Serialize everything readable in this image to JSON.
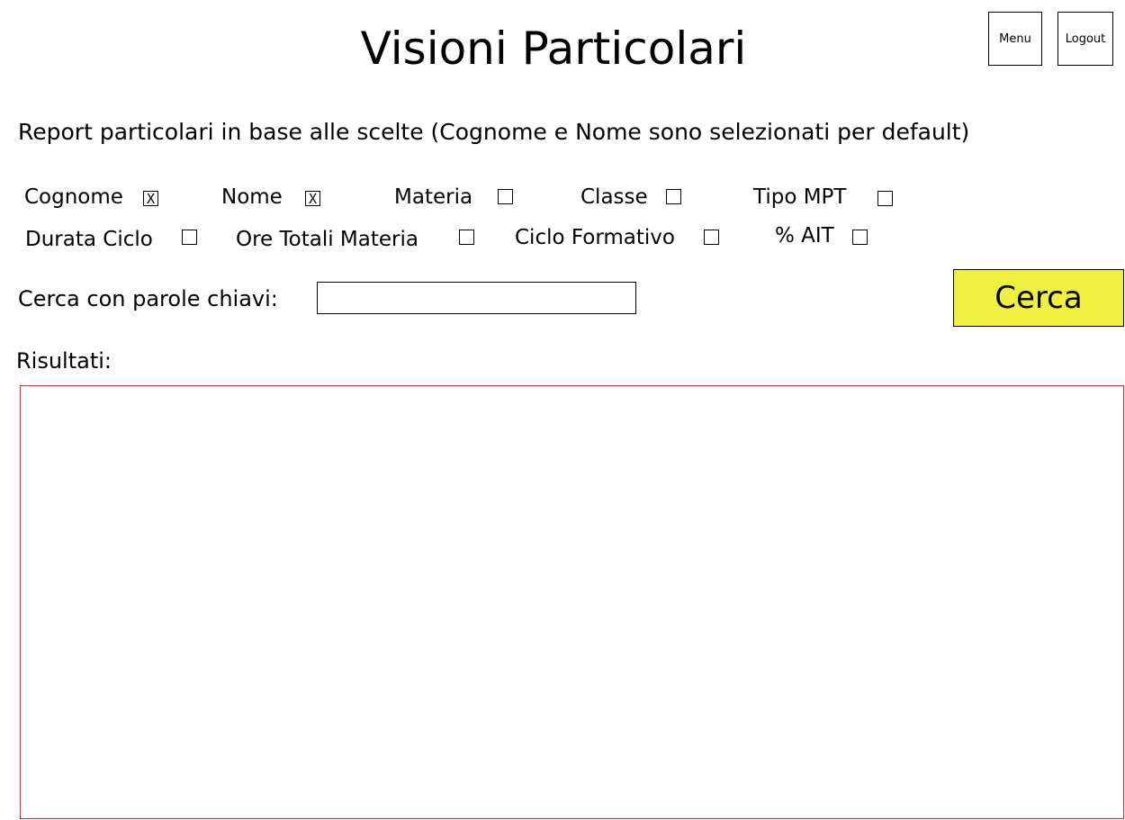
{
  "page": {
    "title": "Visioni Particolari",
    "subtitle": "Report particolari in base alle scelte (Cognome e Nome sono selezionati per default)"
  },
  "header_buttons": {
    "menu": "Menu",
    "logout": "Logout"
  },
  "options": [
    {
      "label": "Cognome",
      "checked": true,
      "mark": "X"
    },
    {
      "label": "Nome",
      "checked": true,
      "mark": "X"
    },
    {
      "label": "Materia",
      "checked": false,
      "mark": ""
    },
    {
      "label": "Classe",
      "checked": false,
      "mark": ""
    },
    {
      "label": "Tipo MPT",
      "checked": false,
      "mark": ""
    },
    {
      "label": "Durata Ciclo",
      "checked": false,
      "mark": ""
    },
    {
      "label": "Ore Totali Materia",
      "checked": false,
      "mark": ""
    },
    {
      "label": "Ciclo Formativo",
      "checked": false,
      "mark": ""
    },
    {
      "label": "% AIT",
      "checked": false,
      "mark": ""
    }
  ],
  "search": {
    "label": "Cerca con parole chiavi:",
    "value": "",
    "placeholder": "",
    "button_label": "Cerca",
    "button_color": "#eef03f"
  },
  "results": {
    "label": "Risultati:",
    "border_color": "#e8232a"
  }
}
